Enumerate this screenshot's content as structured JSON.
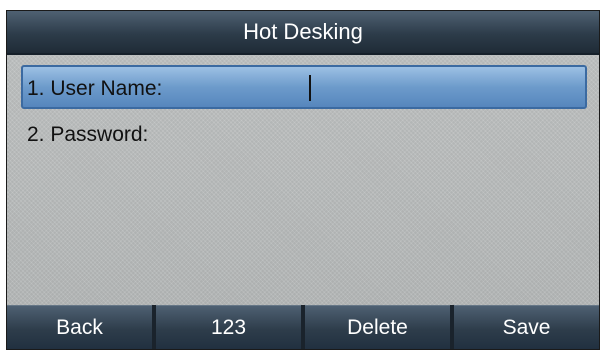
{
  "title": "Hot Desking",
  "fields": [
    {
      "label": "1. User Name:",
      "value": "",
      "focused": true
    },
    {
      "label": "2. Password:",
      "value": "",
      "focused": false
    }
  ],
  "softkeys": [
    "Back",
    "123",
    "Delete",
    "Save"
  ],
  "colors": {
    "title_bar": "#2d3c4a",
    "selected_row": "#6d9bcb",
    "background": "#bcbfbf",
    "text": "#111111"
  }
}
